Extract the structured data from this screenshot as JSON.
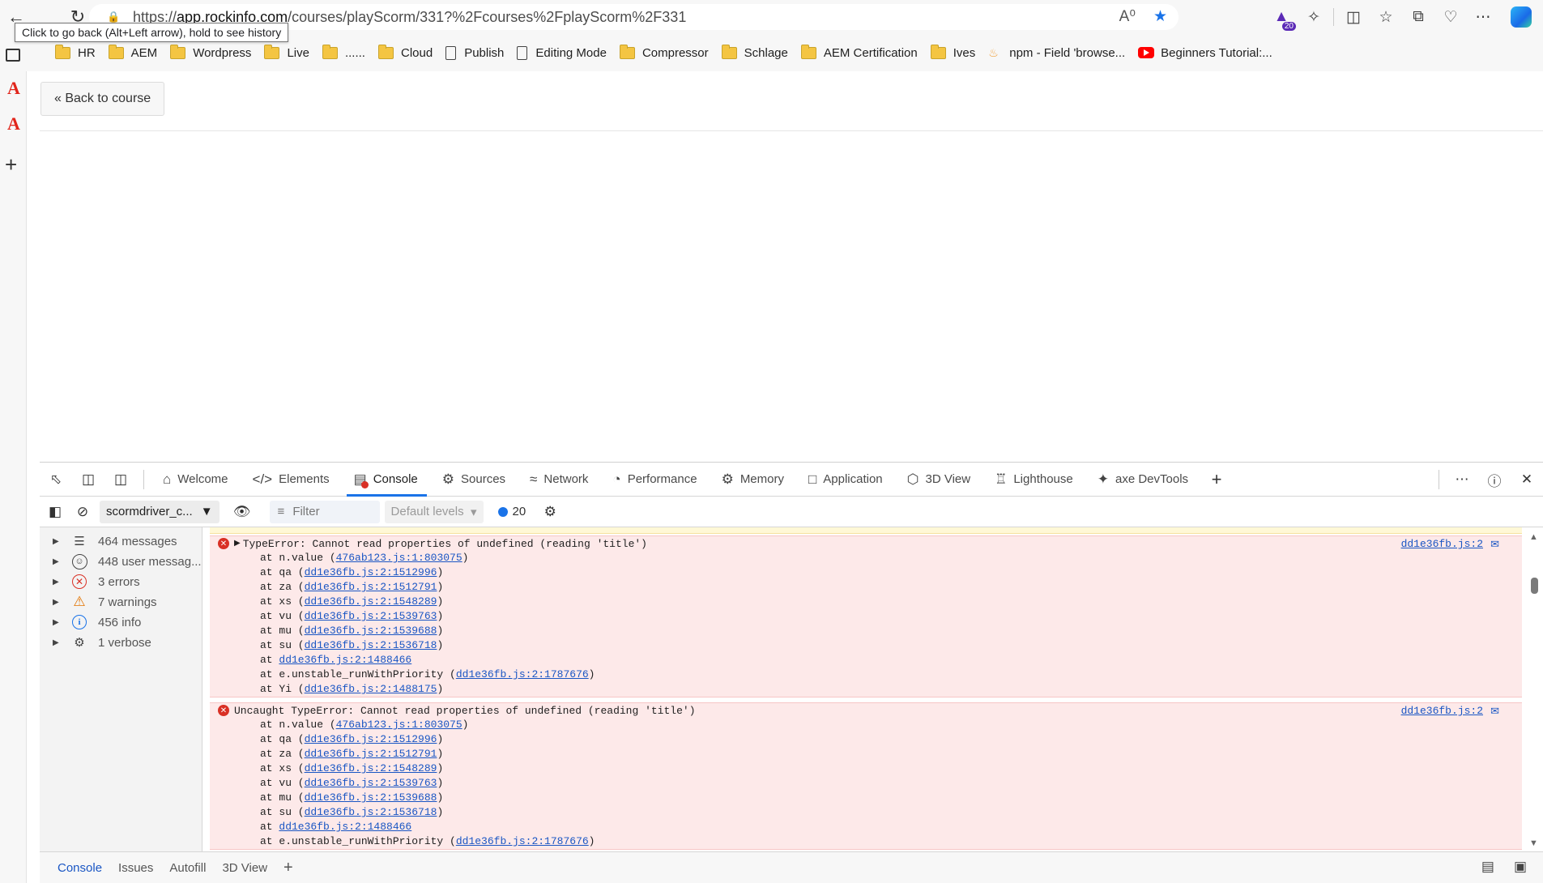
{
  "browser": {
    "url_prefix": "https://",
    "url_host": "app.rockinfo.com",
    "url_path": "/courses/playScorm/331?%2Fcourses%2FplayScorm%2F331",
    "tooltip": "Click to go back (Alt+Left arrow), hold to see history",
    "extension_badge": "20"
  },
  "bookmarks": [
    {
      "label": "HR",
      "icon": "folder"
    },
    {
      "label": "AEM",
      "icon": "folder"
    },
    {
      "label": "Wordpress",
      "icon": "folder"
    },
    {
      "label": "Live",
      "icon": "folder"
    },
    {
      "label": "......",
      "icon": "folder"
    },
    {
      "label": "Cloud",
      "icon": "folder"
    },
    {
      "label": "Publish",
      "icon": "page"
    },
    {
      "label": "Editing Mode",
      "icon": "page"
    },
    {
      "label": "Compressor",
      "icon": "folder"
    },
    {
      "label": "Schlage",
      "icon": "folder"
    },
    {
      "label": "AEM Certification",
      "icon": "folder"
    },
    {
      "label": "Ives",
      "icon": "folder"
    },
    {
      "label": "npm - Field 'browse...",
      "icon": "npm"
    },
    {
      "label": "Beginners Tutorial:...",
      "icon": "youtube"
    }
  ],
  "page": {
    "back_button": "« Back to course"
  },
  "devtools": {
    "tabs": [
      {
        "label": "Welcome",
        "icon": "home"
      },
      {
        "label": "Elements",
        "icon": "code"
      },
      {
        "label": "Console",
        "icon": "console",
        "active": true
      },
      {
        "label": "Sources",
        "icon": "bug"
      },
      {
        "label": "Network",
        "icon": "wifi"
      },
      {
        "label": "Performance",
        "icon": "gauge"
      },
      {
        "label": "Memory",
        "icon": "chip"
      },
      {
        "label": "Application",
        "icon": "window"
      },
      {
        "label": "3D View",
        "icon": "cube"
      },
      {
        "label": "Lighthouse",
        "icon": "lighthouse"
      },
      {
        "label": "axe DevTools",
        "icon": "puzzle"
      }
    ],
    "toolbar": {
      "context": "scormdriver_c...",
      "filter_placeholder": "Filter",
      "levels": "Default levels",
      "issues_count": "20"
    },
    "sidebar": [
      {
        "label": "464 messages",
        "icon": "list"
      },
      {
        "label": "448 user messag...",
        "icon": "user"
      },
      {
        "label": "3 errors",
        "icon": "error"
      },
      {
        "label": "7 warnings",
        "icon": "warning"
      },
      {
        "label": "456 info",
        "icon": "info"
      },
      {
        "label": "1 verbose",
        "icon": "bug"
      }
    ],
    "logs": [
      {
        "message": "TypeError: Cannot read properties of undefined (reading 'title')",
        "expandable": true,
        "source": "dd1e36fb.js:2",
        "frames": [
          {
            "prefix": "at n.value (",
            "link": "476ab123.js:1:803075",
            "suffix": ")"
          },
          {
            "prefix": "at qa (",
            "link": "dd1e36fb.js:2:1512996",
            "suffix": ")"
          },
          {
            "prefix": "at za (",
            "link": "dd1e36fb.js:2:1512791",
            "suffix": ")"
          },
          {
            "prefix": "at xs (",
            "link": "dd1e36fb.js:2:1548289",
            "suffix": ")"
          },
          {
            "prefix": "at vu (",
            "link": "dd1e36fb.js:2:1539763",
            "suffix": ")"
          },
          {
            "prefix": "at mu (",
            "link": "dd1e36fb.js:2:1539688",
            "suffix": ")"
          },
          {
            "prefix": "at su (",
            "link": "dd1e36fb.js:2:1536718",
            "suffix": ")"
          },
          {
            "prefix": "at ",
            "link": "dd1e36fb.js:2:1488466",
            "suffix": ""
          },
          {
            "prefix": "at e.unstable_runWithPriority (",
            "link": "dd1e36fb.js:2:1787676",
            "suffix": ")"
          },
          {
            "prefix": "at Yi (",
            "link": "dd1e36fb.js:2:1488175",
            "suffix": ")"
          }
        ]
      },
      {
        "message": "Uncaught TypeError: Cannot read properties of undefined (reading 'title')",
        "expandable": false,
        "source": "dd1e36fb.js:2",
        "frames": [
          {
            "prefix": "at n.value (",
            "link": "476ab123.js:1:803075",
            "suffix": ")"
          },
          {
            "prefix": "at qa (",
            "link": "dd1e36fb.js:2:1512996",
            "suffix": ")"
          },
          {
            "prefix": "at za (",
            "link": "dd1e36fb.js:2:1512791",
            "suffix": ")"
          },
          {
            "prefix": "at xs (",
            "link": "dd1e36fb.js:2:1548289",
            "suffix": ")"
          },
          {
            "prefix": "at vu (",
            "link": "dd1e36fb.js:2:1539763",
            "suffix": ")"
          },
          {
            "prefix": "at mu (",
            "link": "dd1e36fb.js:2:1539688",
            "suffix": ")"
          },
          {
            "prefix": "at su (",
            "link": "dd1e36fb.js:2:1536718",
            "suffix": ")"
          },
          {
            "prefix": "at ",
            "link": "dd1e36fb.js:2:1488466",
            "suffix": ""
          },
          {
            "prefix": "at e.unstable_runWithPriority (",
            "link": "dd1e36fb.js:2:1787676",
            "suffix": ")"
          }
        ]
      }
    ],
    "drawer_tabs": [
      "Console",
      "Issues",
      "Autofill",
      "3D View"
    ]
  },
  "colors": {
    "accent": "#1a73e8",
    "error_bg": "#fde9e9",
    "error": "#d93025",
    "link": "#1a56c4"
  }
}
